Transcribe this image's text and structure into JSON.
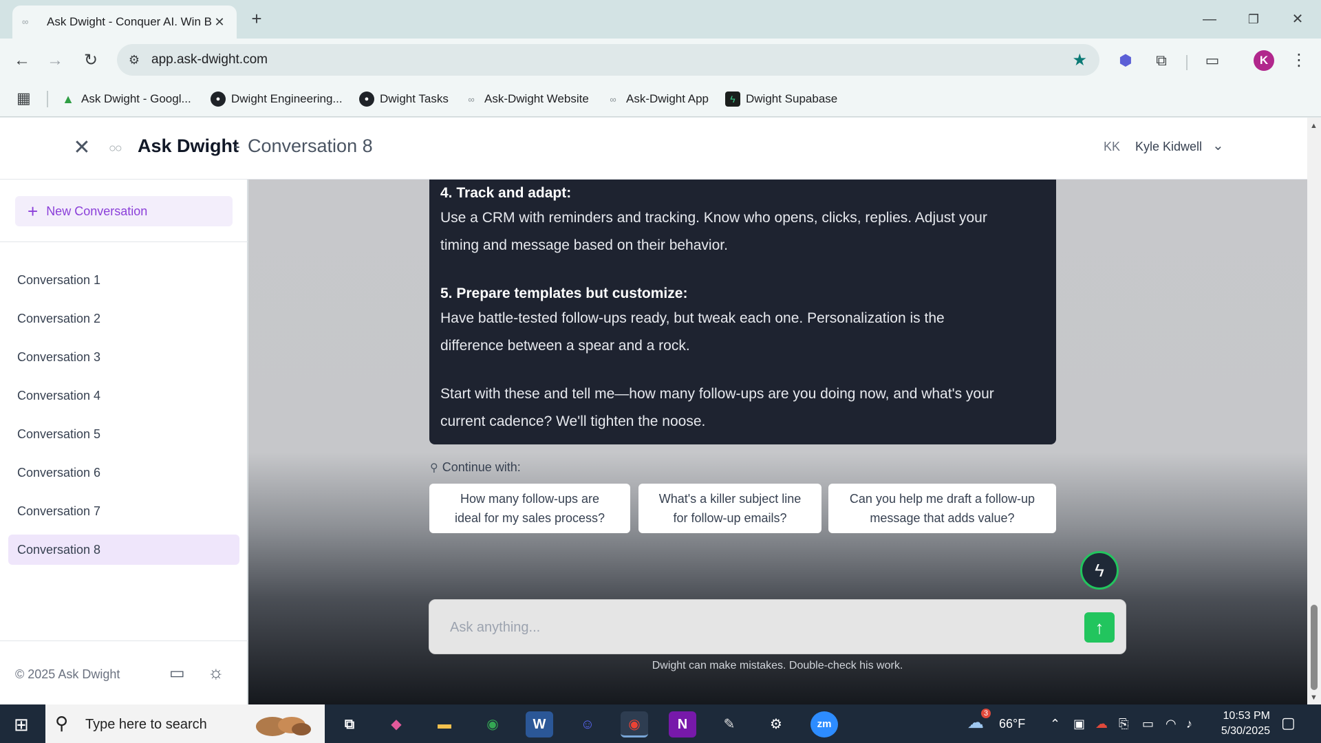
{
  "browser": {
    "tab_title": "Ask Dwight - Conquer AI. Win B",
    "url": "app.ask-dwight.com",
    "profile_initial": "K",
    "bookmarks": [
      {
        "label": "Ask Dwight - Googl...",
        "icon": "drive-icon"
      },
      {
        "label": "Dwight Engineering...",
        "icon": "github-icon"
      },
      {
        "label": "Dwight Tasks",
        "icon": "github-icon"
      },
      {
        "label": "Ask-Dwight Website",
        "icon": "link-icon"
      },
      {
        "label": "Ask-Dwight App",
        "icon": "link-icon"
      },
      {
        "label": "Dwight Supabase",
        "icon": "supabase-icon"
      }
    ]
  },
  "header": {
    "app_name": "Ask Dwight",
    "separator": "-",
    "conversation_title": "Conversation 8",
    "user_initials": "KK",
    "user_name": "Kyle Kidwell"
  },
  "sidebar": {
    "new_conversation": "New Conversation",
    "conversations": [
      "Conversation 1",
      "Conversation 2",
      "Conversation 3",
      "Conversation 4",
      "Conversation 5",
      "Conversation 6",
      "Conversation 7",
      "Conversation 8"
    ],
    "active_index": 7,
    "copyright": "© 2025 Ask Dwight"
  },
  "message": {
    "h4": "4. Track and adapt:",
    "p4a": "Use a CRM with reminders and tracking. Know who opens, clicks, replies. Adjust your",
    "p4b": "timing and message based on their behavior.",
    "h5": "5. Prepare templates but customize:",
    "p5a": "Have battle-tested follow-ups ready, but tweak each one. Personalization is the",
    "p5b": "difference between a spear and a rock.",
    "closing_a": "Start with these and tell me—how many follow-ups are you doing now, and what's your",
    "closing_b": "current cadence? We'll tighten the noose."
  },
  "suggestions": {
    "label": "Continue with:",
    "items": [
      {
        "line1": "How many follow-ups are",
        "line2": "ideal for my sales process?"
      },
      {
        "line1": "What's a killer subject line",
        "line2": "for follow-up emails?"
      },
      {
        "line1": "Can you help me draft a follow-up",
        "line2": "message that adds value?"
      }
    ]
  },
  "composer": {
    "placeholder": "Ask anything...",
    "disclaimer": "Dwight can make mistakes. Double-check his work."
  },
  "taskbar": {
    "search_placeholder": "Type here to search",
    "weather_badge": "3",
    "temperature": "66°F",
    "time": "10:53 PM",
    "date": "5/30/2025"
  },
  "colors": {
    "accent_purple": "#8b3fd9",
    "send_green": "#22c55e",
    "message_bg": "#1e2330",
    "taskbar_bg": "#1d2a3a"
  }
}
